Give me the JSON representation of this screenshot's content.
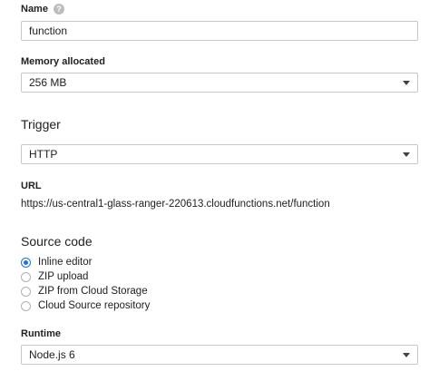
{
  "name": {
    "label": "Name",
    "help_icon": "?",
    "value": "function"
  },
  "memory": {
    "label": "Memory allocated",
    "selected": "256 MB"
  },
  "trigger": {
    "title": "Trigger",
    "selected": "HTTP"
  },
  "url": {
    "label": "URL",
    "value": "https://us-central1-glass-ranger-220613.cloudfunctions.net/function"
  },
  "source_code": {
    "title": "Source code",
    "options": [
      {
        "label": "Inline editor",
        "checked": true
      },
      {
        "label": "ZIP upload",
        "checked": false
      },
      {
        "label": "ZIP from Cloud Storage",
        "checked": false
      },
      {
        "label": "Cloud Source repository",
        "checked": false
      }
    ]
  },
  "runtime": {
    "label": "Runtime",
    "selected": "Node.js 6"
  },
  "colors": {
    "accent": "#1a73e8",
    "border": "#c7c7c7",
    "text": "#212121"
  }
}
